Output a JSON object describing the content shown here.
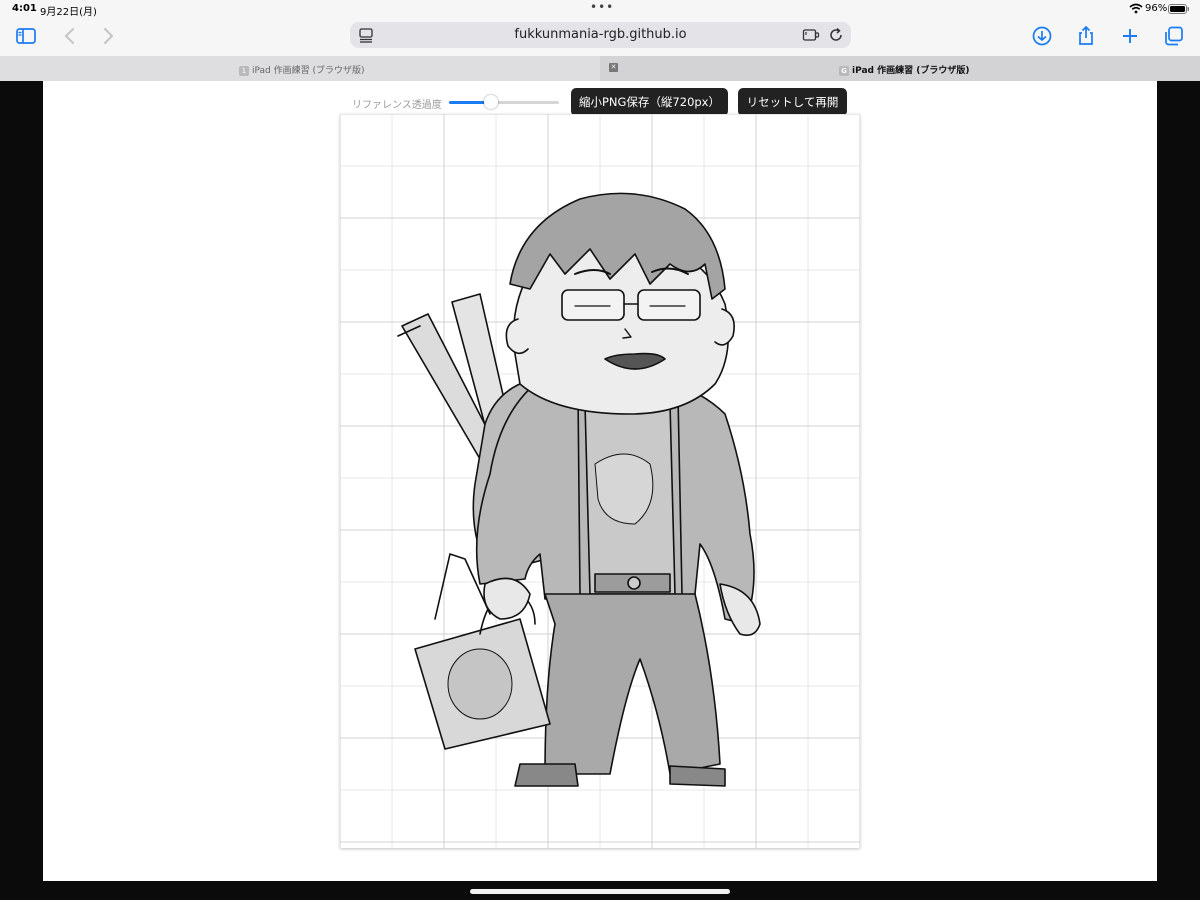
{
  "status_bar": {
    "time": "4:01",
    "date": "9月22日(月)",
    "battery": "96%"
  },
  "browser": {
    "url": "fukkunmania-rgb.github.io",
    "tabs": [
      {
        "title": "iPad 作画練習 (ブラウザ版)",
        "favicon": "1"
      },
      {
        "title": "iPad 作画練習 (ブラウザ版)",
        "favicon": "G"
      }
    ],
    "accent_color": "#1a7cf3"
  },
  "controls": {
    "opacity_label": "リファレンス透過度",
    "opacity_value": 0.38,
    "save_label": "縮小PNG保存（縦720px）",
    "reset_label": "リセットして再開"
  },
  "canvas": {
    "grid_color": "#d0d0d0",
    "content": "pen-sketch-over-reference"
  }
}
